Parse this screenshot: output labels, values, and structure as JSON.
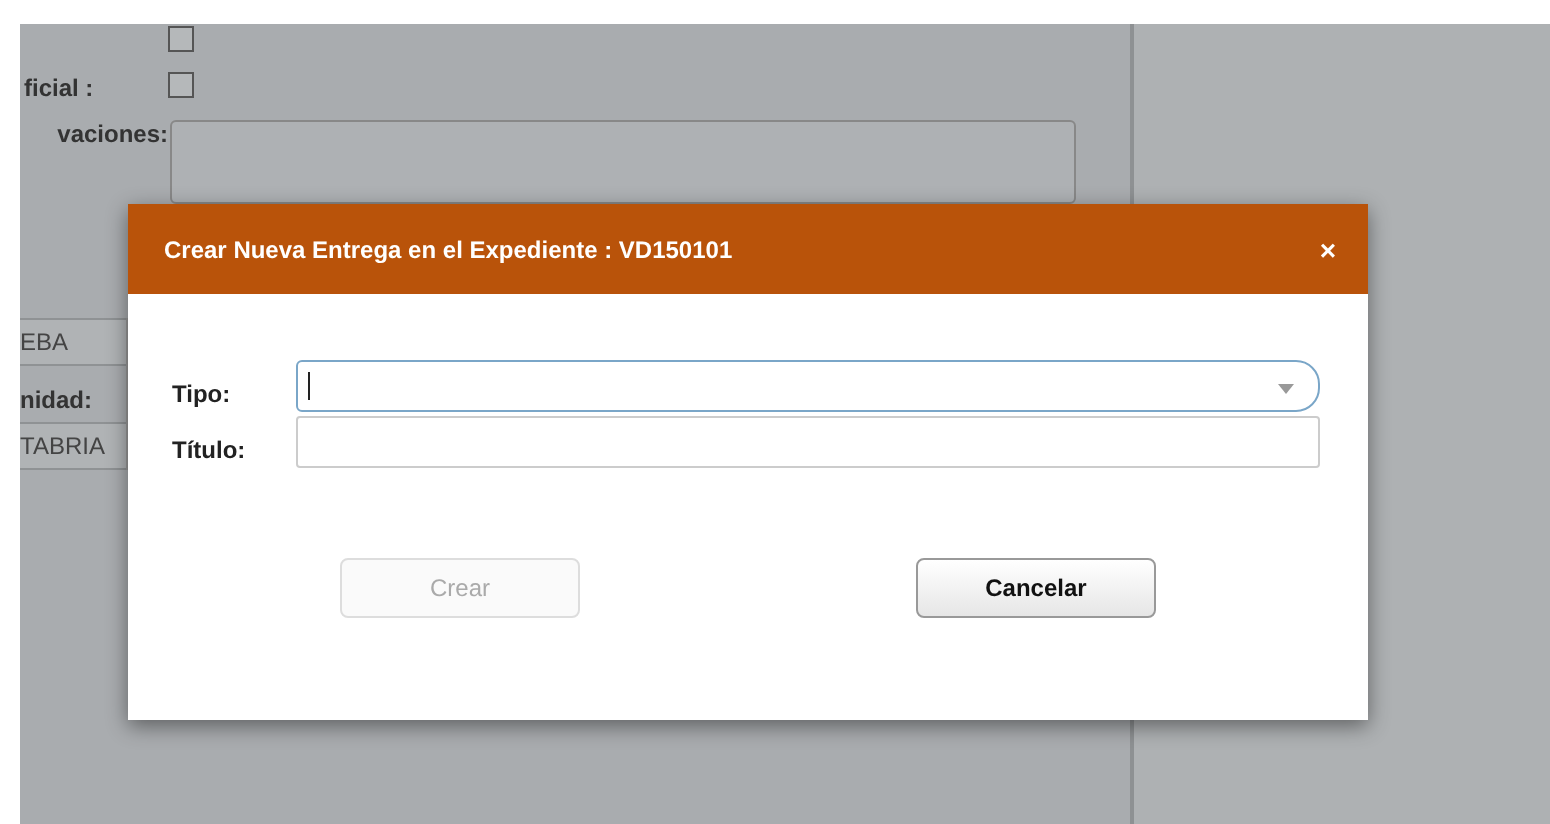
{
  "background_form": {
    "rows": [
      {
        "kind": "checkbox",
        "checked": false
      },
      {
        "kind": "checkbox",
        "label": "ficial :",
        "checked": false
      },
      {
        "kind": "textarea",
        "label": "vaciones:"
      }
    ],
    "side_cells": [
      {
        "kind": "cell",
        "text": "EBA"
      },
      {
        "kind": "label",
        "text": "nidad:"
      },
      {
        "kind": "cell",
        "text": "TABRIA"
      }
    ]
  },
  "dialog": {
    "title": "Crear Nueva Entrega en el Expediente : VD150101",
    "close": "×",
    "fields": [
      {
        "label": "Tipo:",
        "kind": "combo",
        "focused": true
      },
      {
        "label": "Título:",
        "kind": "text",
        "focused": false
      }
    ],
    "buttons": [
      {
        "label": "Crear",
        "disabled": true
      },
      {
        "label": "Cancelar",
        "disabled": false
      }
    ]
  }
}
